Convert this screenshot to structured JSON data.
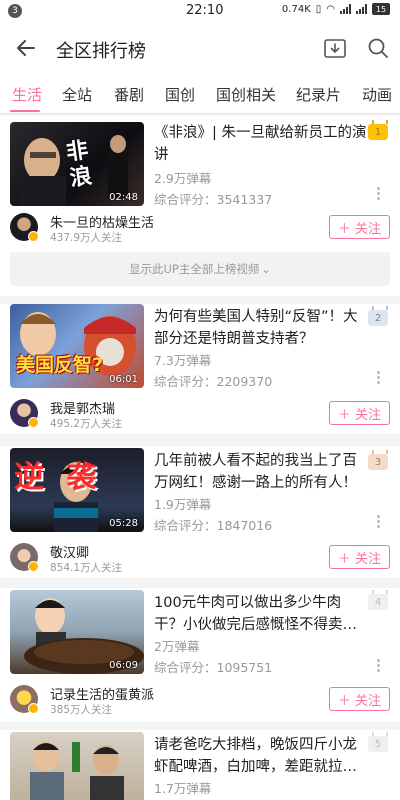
{
  "status_bar": {
    "notification": "3",
    "time": "22:10",
    "network_speed": "0.74K",
    "battery": "15"
  },
  "header": {
    "title": "全区排行榜"
  },
  "tabs": [
    "生活",
    "全站",
    "番剧",
    "国创",
    "国创相关",
    "纪录片",
    "动画"
  ],
  "colors": {
    "accent": "#fb7299",
    "rank_1": "#ffc107",
    "rank_2": "#8fa7c9",
    "rank_3": "#d9a57b",
    "rank_other": "#cccccc"
  },
  "videos": [
    {
      "rank": "1",
      "title": "《非浪》| 朱一旦献给新员工的演讲",
      "danmaku": "2.9万弹幕",
      "score": "综合评分：3541337",
      "duration": "02:48",
      "thumb_text": "非浪",
      "up_name": "朱一旦的枯燥生活",
      "up_followers": "437.9万人关注",
      "follow_label": "＋ 关注"
    },
    {
      "rank": "2",
      "title": "为何有些美国人特别“反智”！大部分还是特朗普支持者？",
      "danmaku": "7.3万弹幕",
      "score": "综合评分：2209370",
      "duration": "06:01",
      "thumb_text": "美国反智?",
      "up_name": "我是郭杰瑞",
      "up_followers": "495.2万人关注",
      "follow_label": "＋ 关注"
    },
    {
      "rank": "3",
      "title": "几年前被人看不起的我当上了百万网红！感谢一路上的所有人！",
      "danmaku": "1.9万弹幕",
      "score": "综合评分：1847016",
      "duration": "05:28",
      "thumb_text": "逆 袭",
      "up_name": "敬汉卿",
      "up_followers": "854.1万人关注",
      "follow_label": "＋ 关注"
    },
    {
      "rank": "4",
      "title": "100元牛肉可以做出多少牛肉干？小伙做完后感慨怪不得卖…",
      "danmaku": "2万弹幕",
      "score": "综合评分：1095751",
      "duration": "06:09",
      "thumb_text": "",
      "up_name": "记录生活的蛋黄派",
      "up_followers": "385万人关注",
      "follow_label": "＋ 关注"
    },
    {
      "rank": "5",
      "title": "请老爸吃大排档，晚饭四斤小龙虾配啤酒，白加啤，差距就拉…",
      "danmaku": "1.7万弹幕",
      "score": "",
      "duration": "",
      "thumb_text": ""
    }
  ],
  "show_all_label": "显示此UP主全部上榜视频"
}
